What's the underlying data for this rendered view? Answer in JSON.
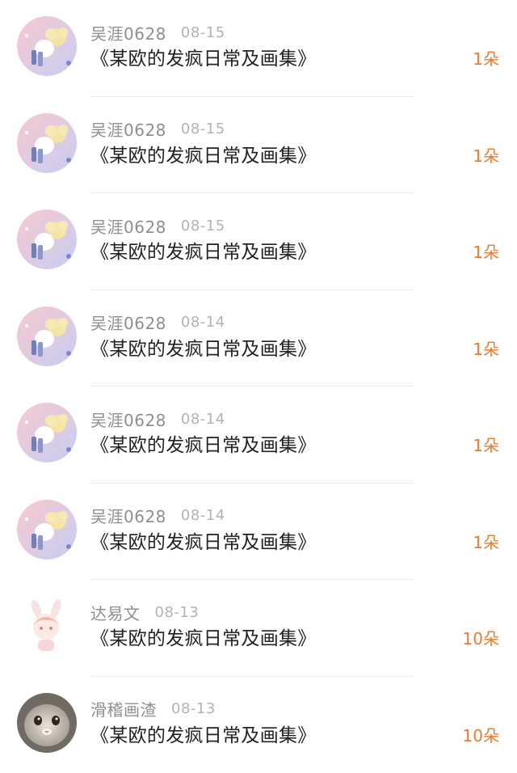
{
  "colors": {
    "username": "#8f8f8f",
    "date": "#b3b3b3",
    "title": "#222222",
    "count_accent": "#f07a2b",
    "divider": "#ececec"
  },
  "items": [
    {
      "user": "吴涯0628",
      "date": "08-15",
      "title": "《某欧的发疯日常及画集》",
      "count": "1朵",
      "avatar_icon": "girl-with-sheep-avatar-icon"
    },
    {
      "user": "吴涯0628",
      "date": "08-15",
      "title": "《某欧的发疯日常及画集》",
      "count": "1朵",
      "avatar_icon": "girl-with-sheep-avatar-icon"
    },
    {
      "user": "吴涯0628",
      "date": "08-15",
      "title": "《某欧的发疯日常及画集》",
      "count": "1朵",
      "avatar_icon": "girl-with-sheep-avatar-icon"
    },
    {
      "user": "吴涯0628",
      "date": "08-14",
      "title": "《某欧的发疯日常及画集》",
      "count": "1朵",
      "avatar_icon": "girl-with-sheep-avatar-icon"
    },
    {
      "user": "吴涯0628",
      "date": "08-14",
      "title": "《某欧的发疯日常及画集》",
      "count": "1朵",
      "avatar_icon": "girl-with-sheep-avatar-icon"
    },
    {
      "user": "吴涯0628",
      "date": "08-14",
      "title": "《某欧的发疯日常及画集》",
      "count": "1朵",
      "avatar_icon": "girl-with-sheep-avatar-icon"
    },
    {
      "user": "达易文",
      "date": "08-13",
      "title": "《某欧的发疯日常及画集》",
      "count": "10朵",
      "avatar_icon": "bunny-girl-avatar-icon"
    },
    {
      "user": "滑稽画渣",
      "date": "08-13",
      "title": "《某欧的发疯日常及画集》",
      "count": "10朵",
      "avatar_icon": "cat-photo-avatar-icon"
    }
  ]
}
